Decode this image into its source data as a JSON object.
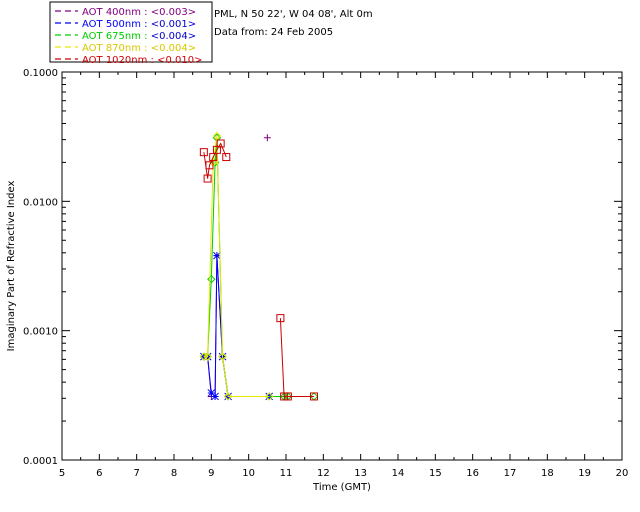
{
  "info": {
    "line1": "PML, N 50 22', W 04 08', Alt 0m",
    "line2": "Data from: 24 Feb 2005"
  },
  "chart_data": {
    "type": "line",
    "title": "",
    "xlabel": "Time (GMT)",
    "ylabel": "Imaginary Part of Refractive Index",
    "xlim": [
      5,
      20
    ],
    "ylim": [
      0.0001,
      0.1
    ],
    "yscale": "log",
    "grid": false,
    "legend_position": "top-left, outside plot",
    "x_ticks": [
      "5",
      "6",
      "7",
      "8",
      "9",
      "10",
      "11",
      "12",
      "13",
      "14",
      "15",
      "16",
      "17",
      "18",
      "19",
      "20"
    ],
    "y_ticks": [
      "0.0001",
      "0.0010",
      "0.0100",
      "0.1000"
    ],
    "series": [
      {
        "name": "AOT  400nm : <0.003>",
        "label_prefix": "AOT  400nm : ",
        "label_value": "<0.003>",
        "label_color": "#800080",
        "color": "#800080",
        "marker": "plus",
        "points": [
          [
            8.8,
            0.00063
          ],
          [
            8.9,
            0.00063
          ],
          [
            9.0,
            0.00031
          ],
          [
            9.1,
            0.00031
          ],
          [
            9.15,
            0.0038
          ],
          [
            9.3,
            0.00063
          ],
          [
            9.45,
            0.00031
          ],
          [
            10.5,
            0.031
          ],
          [
            10.55,
            0.00031
          ]
        ]
      },
      {
        "name": "AOT  500nm : <0.001>",
        "label_prefix": "AOT  500nm : ",
        "label_value": "<0.001>",
        "label_color": "#0000cc",
        "color": "#0000ff",
        "marker": "asterisk",
        "points": [
          [
            8.8,
            0.00063
          ],
          [
            8.9,
            0.00063
          ],
          [
            9.0,
            0.00033
          ],
          [
            9.1,
            0.00031
          ],
          [
            9.15,
            0.0038
          ],
          [
            9.3,
            0.00063
          ],
          [
            9.45,
            0.00031
          ],
          [
            10.55,
            0.00031
          ]
        ]
      },
      {
        "name": "AOT  675nm : <0.004>",
        "label_prefix": "AOT  675nm : ",
        "label_value": "<0.004>",
        "label_color": "#0000cc",
        "color": "#00cc00",
        "marker": "diamond",
        "points": [
          [
            8.8,
            0.00063
          ],
          [
            8.9,
            0.00063
          ],
          [
            9.0,
            0.0025
          ],
          [
            9.1,
            0.02
          ],
          [
            9.15,
            0.031
          ],
          [
            9.3,
            0.00063
          ],
          [
            9.45,
            0.00031
          ],
          [
            10.55,
            0.00031
          ],
          [
            10.95,
            0.00031
          ],
          [
            11.05,
            0.00031
          ],
          [
            11.75,
            0.00031
          ]
        ]
      },
      {
        "name": "AOT  870nm : <0.004>",
        "label_prefix": "AOT  870nm : ",
        "label_value": "<0.004>",
        "label_color": "#d8c800",
        "color": "#e6e600",
        "marker": "diamond",
        "points": [
          [
            8.8,
            0.00063
          ],
          [
            8.9,
            0.00063
          ],
          [
            9.05,
            0.02
          ],
          [
            9.15,
            0.032
          ],
          [
            9.3,
            0.00063
          ],
          [
            9.45,
            0.00031
          ],
          [
            10.55,
            0.00031
          ]
        ]
      },
      {
        "name": "AOT 1020nm : <0.010>",
        "label_prefix": "AOT 1020nm : ",
        "label_value": "<0.010>",
        "label_color": "#cc0000",
        "color": "#cc0000",
        "marker": "square",
        "points": [
          [
            8.8,
            0.024
          ],
          [
            8.9,
            0.015
          ],
          [
            8.95,
            0.019
          ],
          [
            9.05,
            0.022
          ],
          [
            9.15,
            0.025
          ],
          [
            9.25,
            0.028
          ],
          [
            9.4,
            0.022
          ]
        ],
        "points2": [
          [
            10.85,
            0.00125
          ],
          [
            10.95,
            0.00031
          ],
          [
            11.05,
            0.00031
          ],
          [
            11.75,
            0.00031
          ]
        ]
      }
    ]
  }
}
